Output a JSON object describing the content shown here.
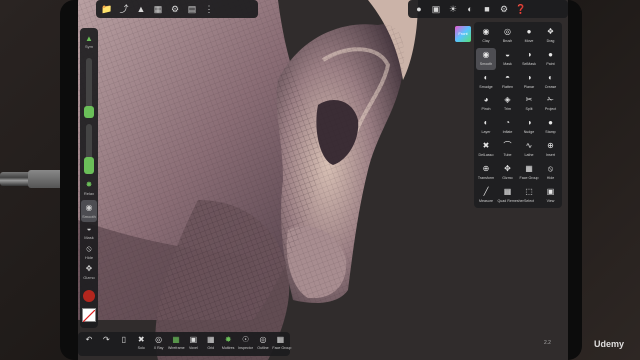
{
  "top_left_toolbar": {
    "icons": [
      "folder-icon",
      "share-icon",
      "scene-icon",
      "grid-icon",
      "gear-icon",
      "layers-icon",
      "more-icon"
    ]
  },
  "top_right_toolbar": {
    "icons": [
      "sphere-icon",
      "camera-icon",
      "lights-icon",
      "material-icon",
      "display-icon",
      "settings-icon",
      "help-icon"
    ]
  },
  "left_sidebar": {
    "top_tool": "Sym",
    "radius_fill": 0.2,
    "intensity_fill": 0.35,
    "tools": [
      {
        "label": "Relax",
        "icon": "relax-icon"
      },
      {
        "label": "Smooth",
        "icon": "smooth-icon"
      },
      {
        "label": "Mask",
        "icon": "mask-icon"
      },
      {
        "label": "Hide",
        "icon": "hide-icon"
      },
      {
        "label": "Gizmo",
        "icon": "gizmo-icon"
      }
    ],
    "color_swatch": "#b3261e"
  },
  "gizmo": {
    "label": "Front"
  },
  "tools_panel": {
    "tools": [
      {
        "label": "Clay",
        "icon": "clay-icon"
      },
      {
        "label": "Brush",
        "icon": "brush-icon"
      },
      {
        "label": "Move",
        "icon": "move-icon"
      },
      {
        "label": "Drag",
        "icon": "drag-icon"
      },
      {
        "label": "Smooth",
        "icon": "smooth-icon",
        "active": true
      },
      {
        "label": "Mask",
        "icon": "mask-icon"
      },
      {
        "label": "SelMask",
        "icon": "selmask-icon"
      },
      {
        "label": "Paint",
        "icon": "paint-icon"
      },
      {
        "label": "Smudge",
        "icon": "smudge-icon"
      },
      {
        "label": "Flatten",
        "icon": "flatten-icon"
      },
      {
        "label": "Planar",
        "icon": "planar-icon"
      },
      {
        "label": "Crease",
        "icon": "crease-icon"
      },
      {
        "label": "Pinch",
        "icon": "pinch-icon"
      },
      {
        "label": "Trim",
        "icon": "trim-icon"
      },
      {
        "label": "Split",
        "icon": "split-icon"
      },
      {
        "label": "Project",
        "icon": "project-icon"
      },
      {
        "label": "Layer",
        "icon": "layer-icon"
      },
      {
        "label": "Inflate",
        "icon": "inflate-icon"
      },
      {
        "label": "Nudge",
        "icon": "nudge-icon"
      },
      {
        "label": "Stamp",
        "icon": "stamp-icon"
      },
      {
        "label": "DelLasso",
        "icon": "dellasso-icon"
      },
      {
        "label": "Tube",
        "icon": "tube-icon"
      },
      {
        "label": "Lathe",
        "icon": "lathe-icon"
      },
      {
        "label": "Insert",
        "icon": "insert-icon"
      },
      {
        "label": "Transform",
        "icon": "transform-icon"
      },
      {
        "label": "Gizmo",
        "icon": "gizmo-icon"
      },
      {
        "label": "Face Group",
        "icon": "facegroup-icon"
      },
      {
        "label": "Hide",
        "icon": "hide-icon"
      },
      {
        "label": "Measure",
        "icon": "measure-icon"
      },
      {
        "label": "Quad Remesher",
        "icon": "quad-remesher-icon"
      },
      {
        "label": "Select",
        "icon": "select-icon"
      },
      {
        "label": "View",
        "icon": "view-icon"
      }
    ]
  },
  "bottom_toolbar": {
    "items": [
      {
        "label": "",
        "icon": "undo-icon"
      },
      {
        "label": "",
        "icon": "redo-icon"
      },
      {
        "label": "",
        "icon": "tablet-icon"
      },
      {
        "label": "Solo",
        "icon": "solo-icon"
      },
      {
        "label": "X Ray",
        "icon": "xray-icon"
      },
      {
        "label": "Wireframe",
        "icon": "wireframe-icon",
        "active": true
      },
      {
        "label": "Voxel",
        "icon": "voxel-icon"
      },
      {
        "label": "Grid",
        "icon": "grid-icon"
      },
      {
        "label": "Multires",
        "icon": "multires-icon",
        "active": true
      },
      {
        "label": "Inspector",
        "icon": "inspector-icon"
      },
      {
        "label": "Outline",
        "icon": "outline-icon"
      },
      {
        "label": "Face Group",
        "icon": "facegroup-icon"
      }
    ]
  },
  "page_number": "2.2",
  "watermark": "Udemy",
  "colors": {
    "accent": "#6bbf59",
    "clay": "#9a7f86",
    "clay_dark": "#4a3a42"
  }
}
